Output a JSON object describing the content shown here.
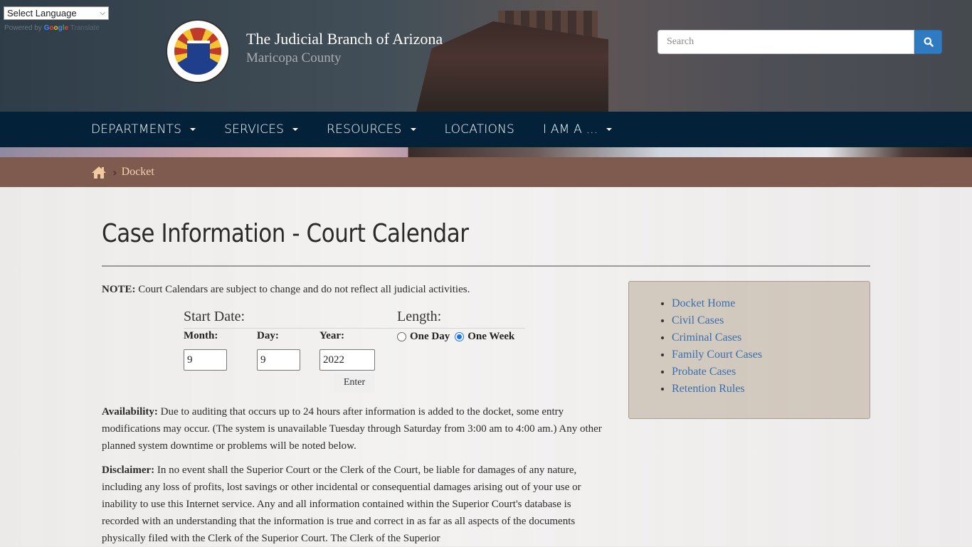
{
  "translate": {
    "select_label": "Select Language",
    "powered_by": "Powered by",
    "google_letters": [
      "G",
      "o",
      "o",
      "g",
      "l",
      "e"
    ],
    "translate_word": "Translate"
  },
  "brand": {
    "title": "The Judicial Branch of Arizona",
    "subtitle": "Maricopa County",
    "seal_alt": "Maricopa County Superior Court seal"
  },
  "search": {
    "placeholder": "Search",
    "value": ""
  },
  "nav": {
    "items": [
      {
        "label": "DEPARTMENTS",
        "has_dropdown": true
      },
      {
        "label": "SERVICES",
        "has_dropdown": true
      },
      {
        "label": "RESOURCES",
        "has_dropdown": true
      },
      {
        "label": "LOCATIONS",
        "has_dropdown": false
      },
      {
        "label": "I AM A ...",
        "has_dropdown": true
      }
    ]
  },
  "breadcrumb": {
    "home_icon": "home-icon",
    "current": "Docket"
  },
  "main": {
    "title": "Case Information - Court Calendar",
    "note_label": "NOTE:",
    "note_text": " Court Calendars are subject to change and do not reflect all judicial activities.",
    "form": {
      "start_date_label": "Start Date:",
      "length_label": "Length:",
      "month_label": "Month:",
      "day_label": "Day:",
      "year_label": "Year:",
      "month_value": "9",
      "day_value": "9",
      "year_value": "2022",
      "length_options": [
        {
          "label": "One Day",
          "selected": false
        },
        {
          "label": "One Week",
          "selected": true
        }
      ],
      "enter_label": "Enter"
    },
    "availability_label": "Availability:",
    "availability_text": " Due to auditing that occurs up to 24 hours after information is added to the docket, some entry modifications may occur. (The system is unavailable Tuesday through Saturday from 3:00 am to 4:00 am.) Any other planned system downtime or problems will be noted below.",
    "disclaimer_label": "Disclaimer:",
    "disclaimer_text": " In no event shall the Superior Court or the Clerk of the Court, be liable for damages of any nature, including any loss of profits, lost savings or other incidental or consequential damages arising out of your use or inability to use this Internet service. Any and all information contained within the Superior Court's database is recorded with an understanding that the information is true and correct in as far as all aspects of the documents physically filed with the Clerk of the Superior Court. The Clerk of the Superior"
  },
  "sidebar": {
    "links": [
      "Docket Home",
      "Civil Cases",
      "Criminal Cases",
      "Family Court Cases",
      "Probate Cases",
      "Retention Rules"
    ]
  },
  "colors": {
    "nav_bg": "#03223a",
    "breadcrumb_bg": "#7e5a4f",
    "breadcrumb_text": "#f3d3b0",
    "search_button": "#2f7bc2",
    "link": "#3a6fae",
    "radio_accent": "#1a73e8"
  }
}
